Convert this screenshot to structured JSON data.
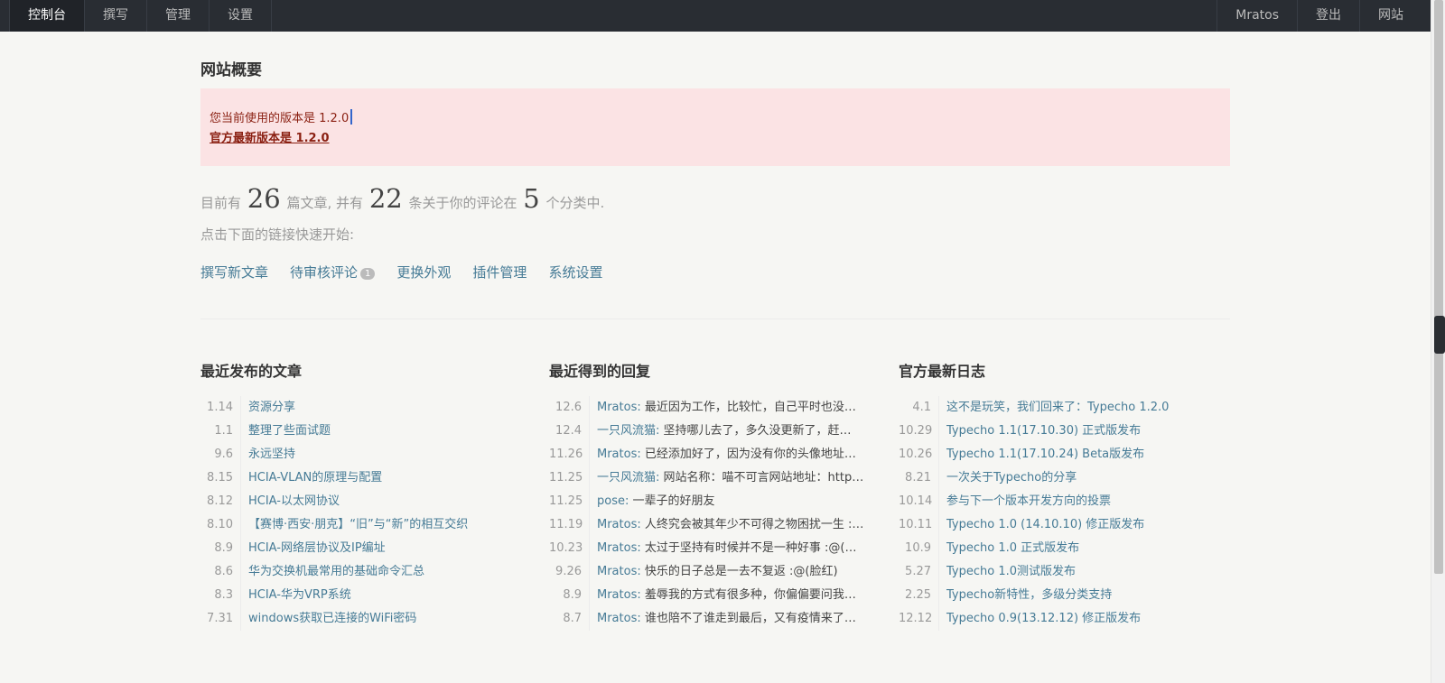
{
  "nav": {
    "left": [
      "控制台",
      "撰写",
      "管理",
      "设置"
    ],
    "right": [
      "Mratos",
      "登出",
      "网站"
    ]
  },
  "page_title": "网站概要",
  "notice": {
    "current_version": "您当前使用的版本是 1.2.0",
    "latest_version": "官方最新版本是 1.2.0"
  },
  "stats": {
    "prefix": "目前有",
    "posts": "26",
    "mid1": "篇文章, 并有",
    "comments": "22",
    "mid2": "条关于你的评论在",
    "categories": "5",
    "suffix": "个分类中."
  },
  "hint": "点击下面的链接快速开始:",
  "quick_links": {
    "write": "撰写新文章",
    "pending": "待审核评论",
    "pending_count": "1",
    "theme": "更换外观",
    "plugins": "插件管理",
    "settings": "系统设置"
  },
  "recent_posts": {
    "title": "最近发布的文章",
    "items": [
      {
        "date": "1.14",
        "title": "资源分享"
      },
      {
        "date": "1.1",
        "title": "整理了些面试题"
      },
      {
        "date": "9.6",
        "title": "永远坚持"
      },
      {
        "date": "8.15",
        "title": "HCIA-VLAN的原理与配置"
      },
      {
        "date": "8.12",
        "title": "HCIA-以太网协议"
      },
      {
        "date": "8.10",
        "title": "【赛博·西安·朋克】“旧”与“新”的相互交织"
      },
      {
        "date": "8.9",
        "title": "HCIA-网络层协议及IP编址"
      },
      {
        "date": "8.6",
        "title": "华为交换机最常用的基础命令汇总"
      },
      {
        "date": "8.3",
        "title": "HCIA-华为VRP系统"
      },
      {
        "date": "7.31",
        "title": "windows获取已连接的WiFi密码"
      }
    ]
  },
  "recent_replies": {
    "title": "最近得到的回复",
    "items": [
      {
        "date": "12.6",
        "author": "Mratos",
        "text": "最近因为工作，比较忙，自己平时也没…"
      },
      {
        "date": "12.4",
        "author": "一只风流猫",
        "text": "坚持哪儿去了，多久没更新了，赶…"
      },
      {
        "date": "11.26",
        "author": "Mratos",
        "text": "已经添加好了，因为没有你的头像地址…"
      },
      {
        "date": "11.25",
        "author": "一只风流猫",
        "text": "网站名称：喵不可言网站地址：http…"
      },
      {
        "date": "11.25",
        "author": "pose",
        "text": "一辈子的好朋友"
      },
      {
        "date": "11.19",
        "author": "Mratos",
        "text": "人终究会被其年少不可得之物困扰一生 :…"
      },
      {
        "date": "10.23",
        "author": "Mratos",
        "text": "太过于坚持有时候并不是一种好事 :@(…"
      },
      {
        "date": "9.26",
        "author": "Mratos",
        "text": "快乐的日子总是一去不复返 :@(脸红)"
      },
      {
        "date": "8.9",
        "author": "Mratos",
        "text": "羞辱我的方式有很多种，你偏偏要问我…"
      },
      {
        "date": "8.7",
        "author": "Mratos",
        "text": "谁也陪不了谁走到最后，又有疫情来了…"
      }
    ]
  },
  "official_log": {
    "title": "官方最新日志",
    "items": [
      {
        "date": "4.1",
        "title": "这不是玩笑，我们回来了：Typecho 1.2.0"
      },
      {
        "date": "10.29",
        "title": "Typecho 1.1(17.10.30) 正式版发布"
      },
      {
        "date": "10.26",
        "title": "Typecho 1.1(17.10.24) Beta版发布"
      },
      {
        "date": "8.21",
        "title": "一次关于Typecho的分享"
      },
      {
        "date": "10.14",
        "title": "参与下一个版本开发方向的投票"
      },
      {
        "date": "10.11",
        "title": "Typecho 1.0 (14.10.10) 修正版发布"
      },
      {
        "date": "10.9",
        "title": "Typecho 1.0 正式版发布"
      },
      {
        "date": "5.27",
        "title": "Typecho 1.0测试版发布"
      },
      {
        "date": "2.25",
        "title": "Typecho新特性，多级分类支持"
      },
      {
        "date": "12.12",
        "title": "Typecho 0.9(13.12.12) 修正版发布"
      }
    ]
  }
}
